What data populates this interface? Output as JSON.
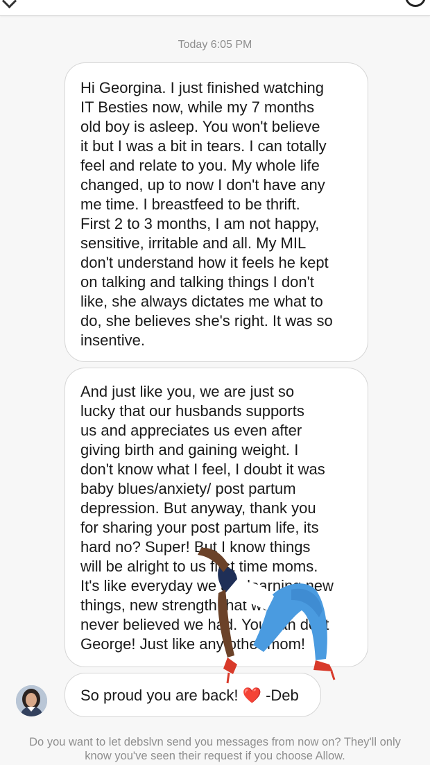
{
  "header": {
    "back_icon": "chevron-left-icon",
    "info_icon": "info-circle-icon"
  },
  "conversation": {
    "timestamp": "Today 6:05 PM",
    "messages": [
      "Hi Georgina. I just finished watching\nIT Besties now, while my 7 months\nold boy is asleep. You won't believe\nit but I was a bit in tears. I can totally\nfeel and relate to you. My whole life\nchanged, up to now I don't have any\nme time. I breastfeed to be thrift.\nFirst 2 to 3 months, I am not happy,\nsensitive, irritable and all. My MIL\ndon't understand how it feels he kept\non talking and talking things I don't\nlike, she always dictates me what to\ndo, she believes she's right. It was so\ninsentive.",
      "And just like you, we are just so\nlucky that our husbands supports\nus and appreciates us even after\ngiving birth and gaining weight. I\ndon't know what I feel, I doubt it was\nbaby blues/anxiety/ post partum\ndepression. But anyway, thank you\nfor sharing your post partum life, its\nhard no? Super! But I know things\nwill be alright to us first time moms.\nIt's like everyday we are learning new\nthings, new strength that we\nnever believed we had. You can do it\nGeorge! Just like any other mom!",
      "So proud you are back! ❤️ -Deb"
    ]
  },
  "request": {
    "notice": "Do you want to let debslvn send you messages from now on? They'll only\nknow you've seen their request if you choose Allow."
  },
  "colors": {
    "background": "#f7f7f7",
    "bubble": "#ffffff",
    "bubble_border": "#d6d6d6",
    "muted_text": "#8e8e8e",
    "heart": "#e0253a"
  },
  "decorations": {
    "sticker": "woman-doing-yoga-pose-sticker-icon"
  }
}
